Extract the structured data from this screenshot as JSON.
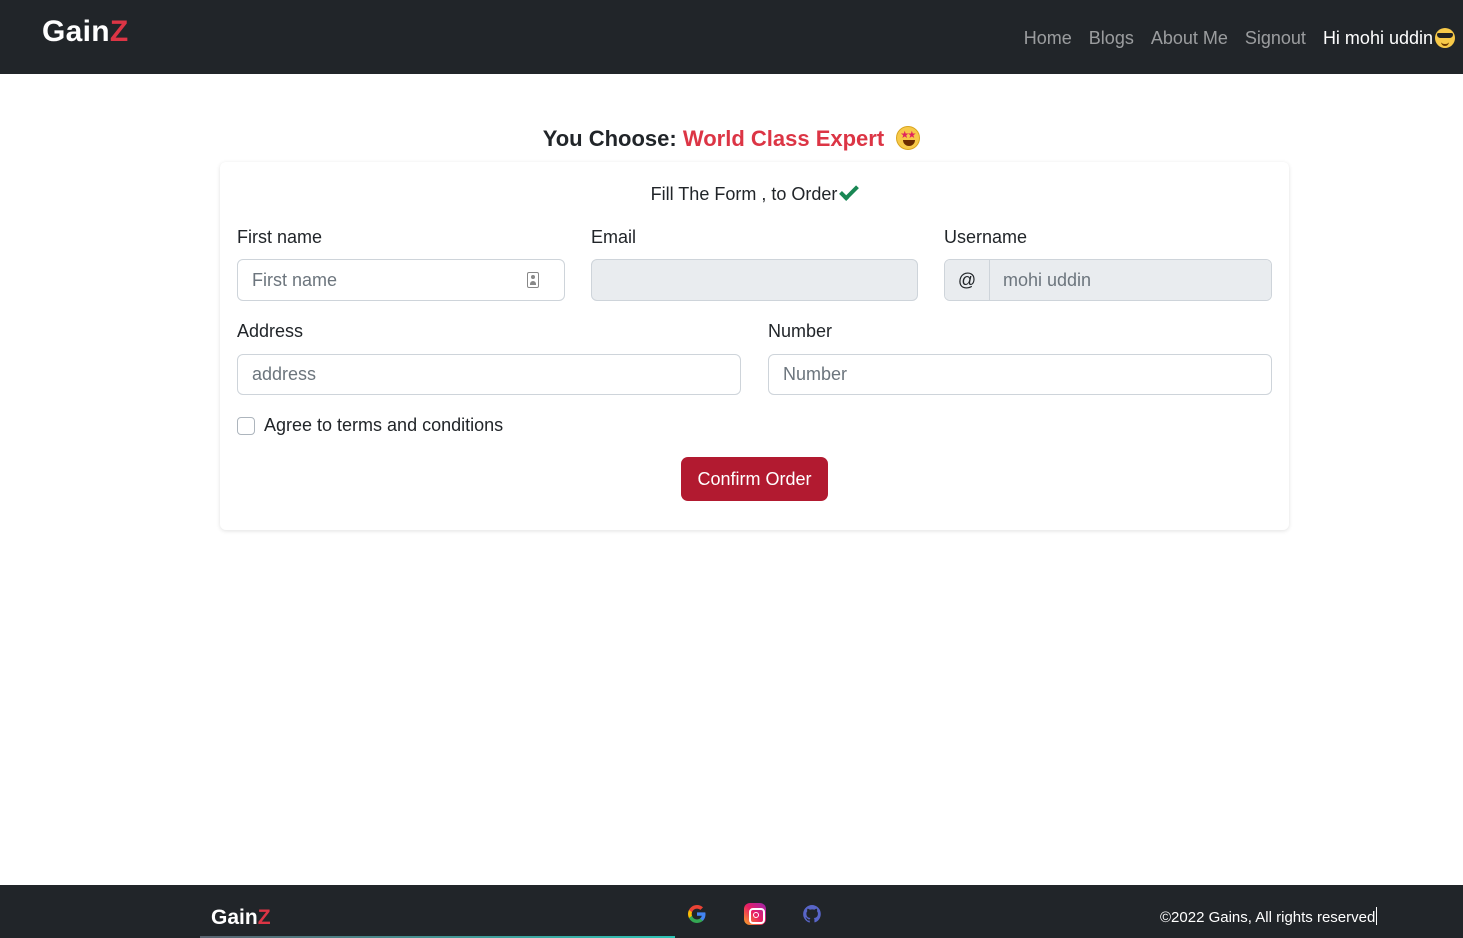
{
  "header": {
    "brand_main": "Gain",
    "brand_accent": "Z",
    "nav": [
      "Home",
      "Blogs",
      "About Me",
      "Signout"
    ],
    "greeting": "Hi mohi uddin",
    "greeting_icon": "sunglasses-face-icon"
  },
  "heading": {
    "prefix": "You Choose:",
    "package": "World Class Expert",
    "icon": "star-struck-face-icon"
  },
  "form": {
    "subtitle": "Fill The Form , to Order",
    "subtitle_icon": "check-mark-icon",
    "first_name": {
      "label": "First name",
      "placeholder": "First name",
      "value": ""
    },
    "email": {
      "label": "Email",
      "placeholder": "",
      "value": ""
    },
    "username": {
      "label": "Username",
      "prefix": "@",
      "placeholder": "mohi uddin"
    },
    "address": {
      "label": "Address",
      "placeholder": "address",
      "value": ""
    },
    "number": {
      "label": "Number",
      "placeholder": "Number",
      "value": ""
    },
    "terms_label": "Agree to terms and conditions",
    "terms_checked": false,
    "submit_label": "Confirm Order"
  },
  "footer": {
    "brand_main": "Gain",
    "brand_accent": "Z",
    "social_icons": [
      "google-icon",
      "instagram-icon",
      "github-icon"
    ],
    "copyright": "©2022 Gains, All rights reserved"
  },
  "colors": {
    "navbar_bg": "#212529",
    "accent_red": "#dc3545",
    "button_bg": "#b21a30",
    "check_green": "#198754"
  }
}
